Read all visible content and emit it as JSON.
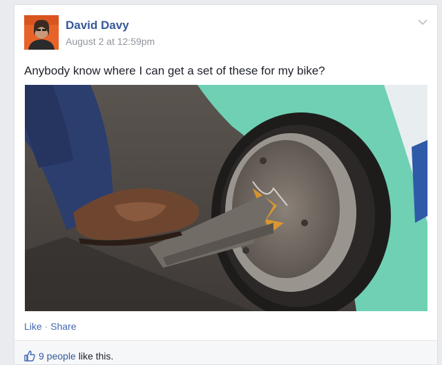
{
  "post": {
    "author": "David Davy",
    "timestamp": "August 2 at 12:59pm",
    "text": "Anybody know where I can get a set of these for my bike?",
    "menu_icon": "chevron-down-icon",
    "avatar_icon": "profile-photo"
  },
  "actions": {
    "like": "Like",
    "separator": "·",
    "share": "Share"
  },
  "likes": {
    "icon": "thumbs-up-icon",
    "count_text": "9 people",
    "suffix": "like this."
  },
  "colors": {
    "link": "#365899",
    "action_link": "#4267b2",
    "meta_text": "#90949c",
    "body_text": "#1d2129",
    "page_bg": "#e9ebee",
    "car_teal": "#6fd0b4"
  }
}
